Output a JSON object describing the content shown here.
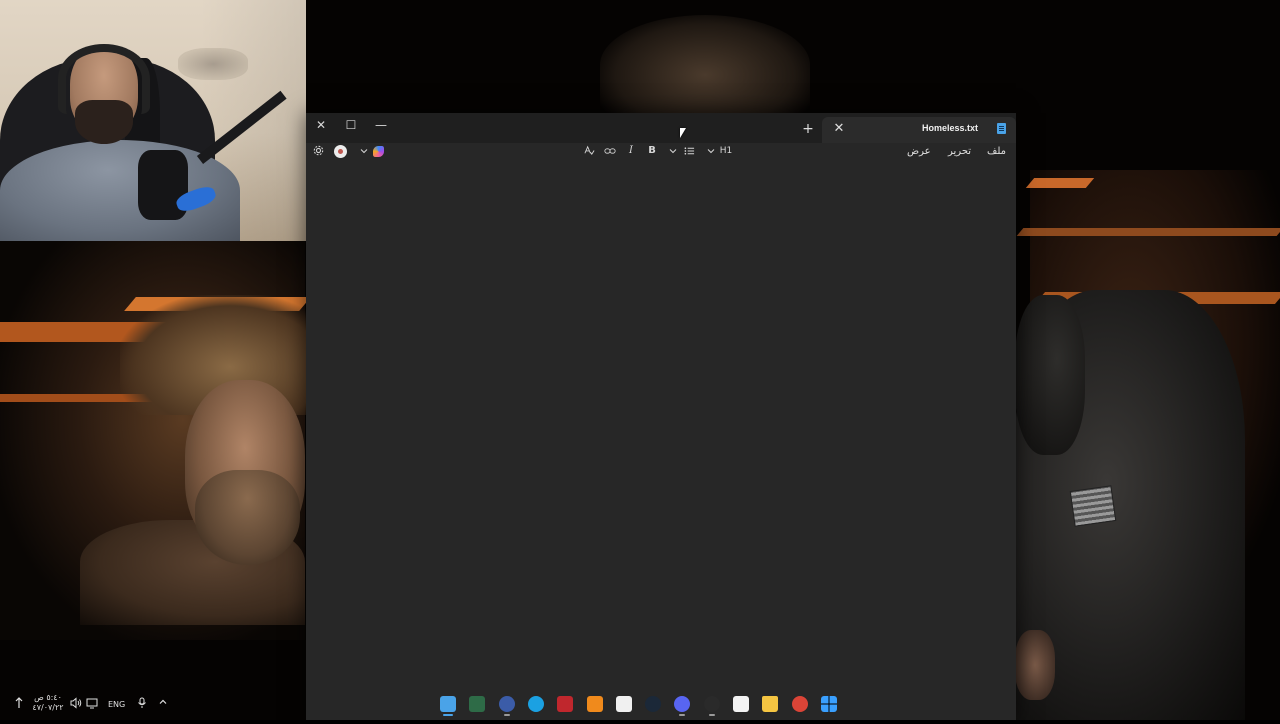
{
  "notepad": {
    "tab_title": "Homeless.txt",
    "menu": {
      "file": "ملف",
      "edit": "تحرير",
      "view": "عرض"
    },
    "toolbar": {
      "heading": "H1",
      "bold": "B",
      "italic": "I"
    },
    "window_controls": {
      "close": "✕",
      "maximize": "☐",
      "minimize": "—"
    },
    "new_tab": "+",
    "tab_close": "✕",
    "editor_content": ""
  },
  "taskbar": {
    "time": "٥:٤٠ ص",
    "date": "٤٧/٠٧/٢٢",
    "language": "ENG",
    "apps": [
      {
        "name": "notepad-icon",
        "color": "#4aa3e8"
      },
      {
        "name": "excel-icon",
        "color": "#2e6b47"
      },
      {
        "name": "app-icon",
        "color": "#3b5ca8"
      },
      {
        "name": "edge-icon",
        "color": "#1ba1e2"
      },
      {
        "name": "filezilla-icon",
        "color": "#c0272d"
      },
      {
        "name": "vlc-icon",
        "color": "#f08a1c"
      },
      {
        "name": "capcut-icon",
        "color": "#f0f0f0"
      },
      {
        "name": "steam-icon",
        "color": "#1b2838"
      },
      {
        "name": "discord-icon",
        "color": "#5865f2"
      },
      {
        "name": "clock-app-icon",
        "color": "#2a2a2a"
      },
      {
        "name": "store-icon",
        "color": "#f3f3f3"
      },
      {
        "name": "file-explorer-icon",
        "color": "#f5c542"
      },
      {
        "name": "chrome-icon",
        "color": "#db4437"
      },
      {
        "name": "windows-icon",
        "color": "#3aa0ff"
      }
    ]
  },
  "colors": {
    "accent": "#4aa3e8",
    "window_bg": "#272727",
    "titlebar_bg": "#1f1f1f",
    "stripe": "#c8682a"
  }
}
